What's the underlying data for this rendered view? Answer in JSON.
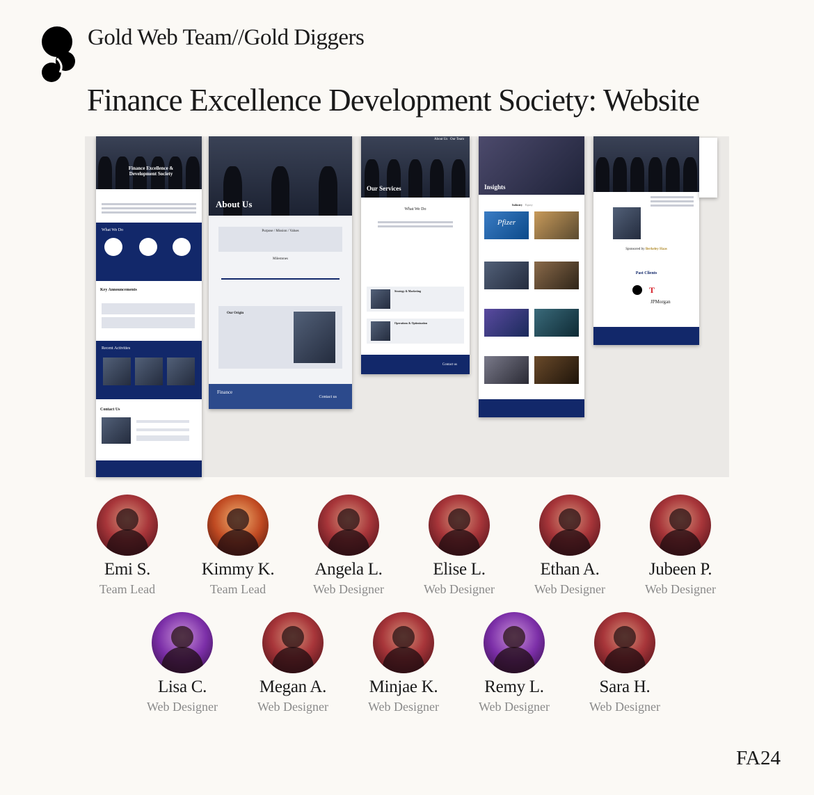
{
  "header": {
    "team": "Gold Web Team//Gold Diggers",
    "project": "Finance Excellence Development Society: Website"
  },
  "screens": {
    "home": {
      "hero_title": "Finance Excellence & Development Society",
      "what_we_do": "What We Do",
      "key_announcements": "Key Announcements",
      "recent_activities": "Recent Activities",
      "contact_us": "Contact Us"
    },
    "about": {
      "hero_title": "About Us",
      "brand": "Finance",
      "section": "Purpose / Mission / Values",
      "milestones": "Milestones",
      "origin": "Our Origin",
      "contact": "Contact us"
    },
    "services": {
      "hero_title": "Our Services",
      "nav": [
        "About Us",
        "Our Team"
      ],
      "section": "What We Do",
      "service_1": "Strategy & Marketing",
      "service_2": "Operations & Optimization",
      "contact": "Contact us"
    },
    "insights": {
      "hero_title": "Insights",
      "tabs": [
        "Industry",
        "Equity"
      ],
      "pfizer": "Pfizer"
    },
    "clients": {
      "sponsor_label": "Sponsored by",
      "sponsor": "Berkeley Haas",
      "past_clients": "Past Clients",
      "clients": [
        "JPMorgan"
      ]
    }
  },
  "members": [
    {
      "name": "Emi S.",
      "role": "Team Lead",
      "tone": "red"
    },
    {
      "name": "Kimmy K.",
      "role": "Team Lead",
      "tone": "orange"
    },
    {
      "name": "Angela L.",
      "role": "Web Designer",
      "tone": "red"
    },
    {
      "name": "Elise L.",
      "role": "Web Designer",
      "tone": "red"
    },
    {
      "name": "Ethan A.",
      "role": "Web Designer",
      "tone": "red"
    },
    {
      "name": "Jubeen P.",
      "role": "Web Designer",
      "tone": "red"
    },
    {
      "name": "Lisa C.",
      "role": "Web Designer",
      "tone": "purple"
    },
    {
      "name": "Megan A.",
      "role": "Web Designer",
      "tone": "red"
    },
    {
      "name": "Minjae K.",
      "role": "Web Designer",
      "tone": "red"
    },
    {
      "name": "Remy L.",
      "role": "Web Designer",
      "tone": "purple"
    },
    {
      "name": "Sara H.",
      "role": "Web Designer",
      "tone": "red"
    }
  ],
  "footer": {
    "season": "FA24"
  },
  "colors": {
    "navy": "#12286a",
    "page_bg": "#fbf9f5",
    "role_gray": "#8a8a8a"
  }
}
